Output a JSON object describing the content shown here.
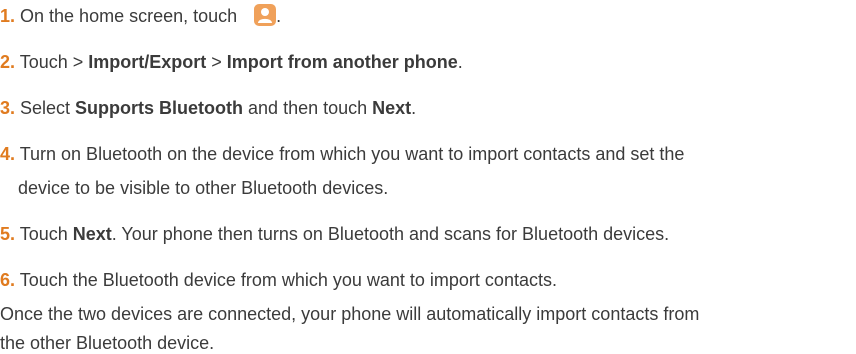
{
  "steps": [
    {
      "num": "1.",
      "text_before": " On the home screen, touch ",
      "text_after": "."
    },
    {
      "num": "2.",
      "t1": " Touch > ",
      "b1": "Import/Export",
      "t2": " > ",
      "b2": "Import from another phone",
      "t3": "."
    },
    {
      "num": "3.",
      "t1": " Select ",
      "b1": "Supports Bluetooth",
      "t2": " and then touch ",
      "b2": "Next",
      "t3": "."
    },
    {
      "num": "4.",
      "line1": " Turn on Bluetooth on the device from which you want to import contacts and set the",
      "line2": "device to be visible to other Bluetooth devices."
    },
    {
      "num": "5.",
      "t1": " Touch ",
      "b1": "Next",
      "t2": ". Your phone then turns on Bluetooth and scans for Bluetooth devices."
    },
    {
      "num": "6.",
      "text": " Touch the Bluetooth device from which you want to import contacts."
    }
  ],
  "closing": {
    "line1": "Once the two devices are connected, your phone will automatically import contacts from",
    "line2": "the other Bluetooth device."
  },
  "icons": {
    "contacts": "contacts-app-icon"
  },
  "colors": {
    "step_number": "#e07b1f",
    "icon_bg": "#f0a15a",
    "text": "#3b3b3b"
  }
}
